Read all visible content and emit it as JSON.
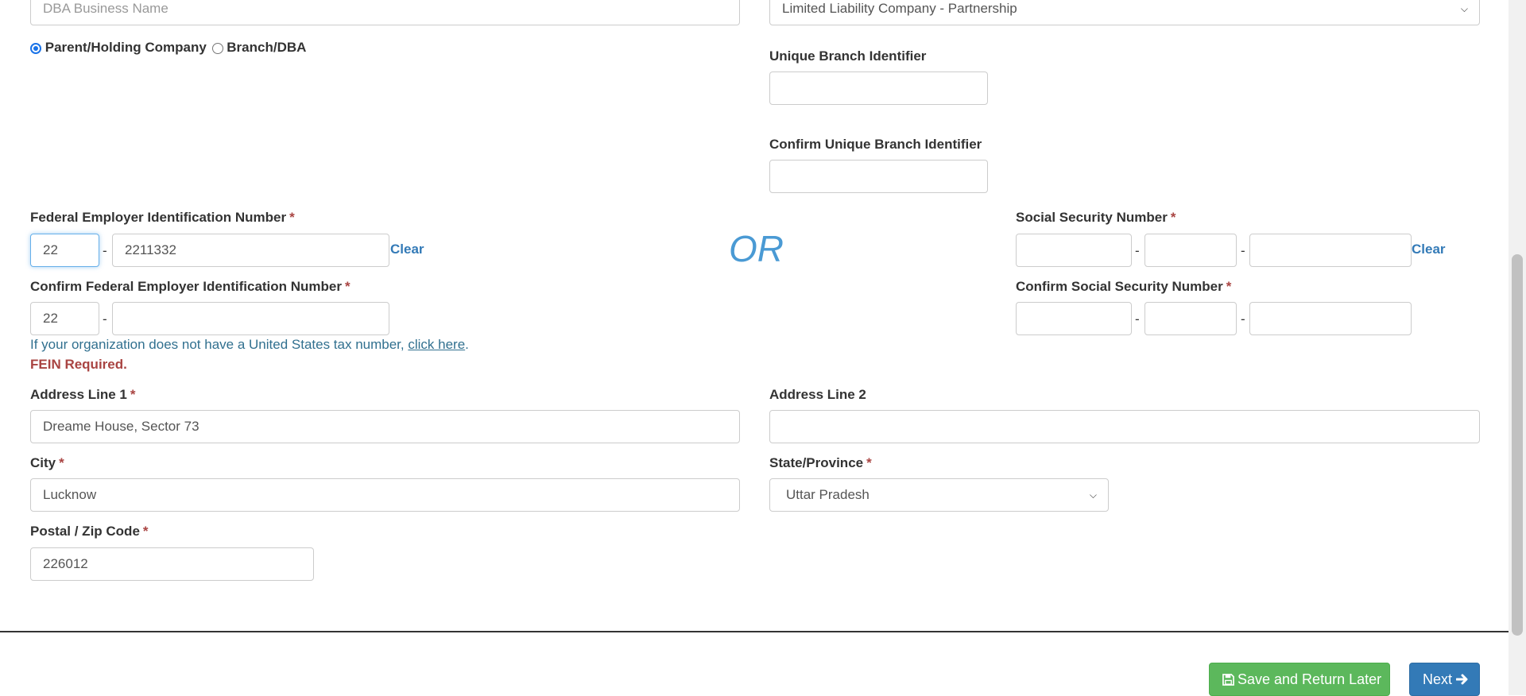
{
  "dba": {
    "placeholder": "DBA Business Name"
  },
  "entity_type": {
    "selected": "Limited Liability Company - Partnership"
  },
  "company_type": {
    "option_parent": "Parent/Holding Company",
    "option_branch": "Branch/DBA",
    "selected": "Parent/Holding Company"
  },
  "branch": {
    "label": "Unique Branch Identifier",
    "value": "",
    "confirm_label": "Confirm Unique Branch Identifier",
    "confirm_value": ""
  },
  "fein": {
    "label": "Federal Employer Identification Number",
    "required_mark": "*",
    "part1": "22",
    "part2": "2211332",
    "dash": "-",
    "clear": "Clear",
    "confirm_label": "Confirm Federal Employer Identification Number",
    "confirm_part1": "22",
    "confirm_part2": ""
  },
  "or_text": "OR",
  "ssn": {
    "label": "Social Security Number",
    "required_mark": "*",
    "part1": "",
    "part2": "",
    "part3": "",
    "clear": "Clear",
    "confirm_label": "Confirm Social Security Number",
    "confirm_part1": "",
    "confirm_part2": "",
    "confirm_part3": ""
  },
  "tax_hint": {
    "text": "If your organization does not have a United States tax number,",
    "link": "click here",
    "end": "."
  },
  "error": "FEIN Required.",
  "address1": {
    "label": "Address Line 1",
    "required_mark": "*",
    "value": "Dreame House, Sector 73"
  },
  "address2": {
    "label": "Address Line 2",
    "value": ""
  },
  "city": {
    "label": "City",
    "required_mark": "*",
    "value": "Lucknow"
  },
  "state": {
    "label": "State/Province",
    "required_mark": "*",
    "selected": "Uttar Pradesh"
  },
  "postal": {
    "label": "Postal / Zip Code",
    "required_mark": "*",
    "value": "226012"
  },
  "buttons": {
    "save": "Save and Return Later",
    "next": "Next"
  },
  "icons": {
    "save": "floppy-disk-icon",
    "next": "arrow-right-icon",
    "select": "chevron-down-icon"
  },
  "colors": {
    "primary": "#337ab7",
    "success": "#5cb85c",
    "required": "#a94442",
    "or": "#4a9ad4",
    "hint": "#31708f"
  }
}
